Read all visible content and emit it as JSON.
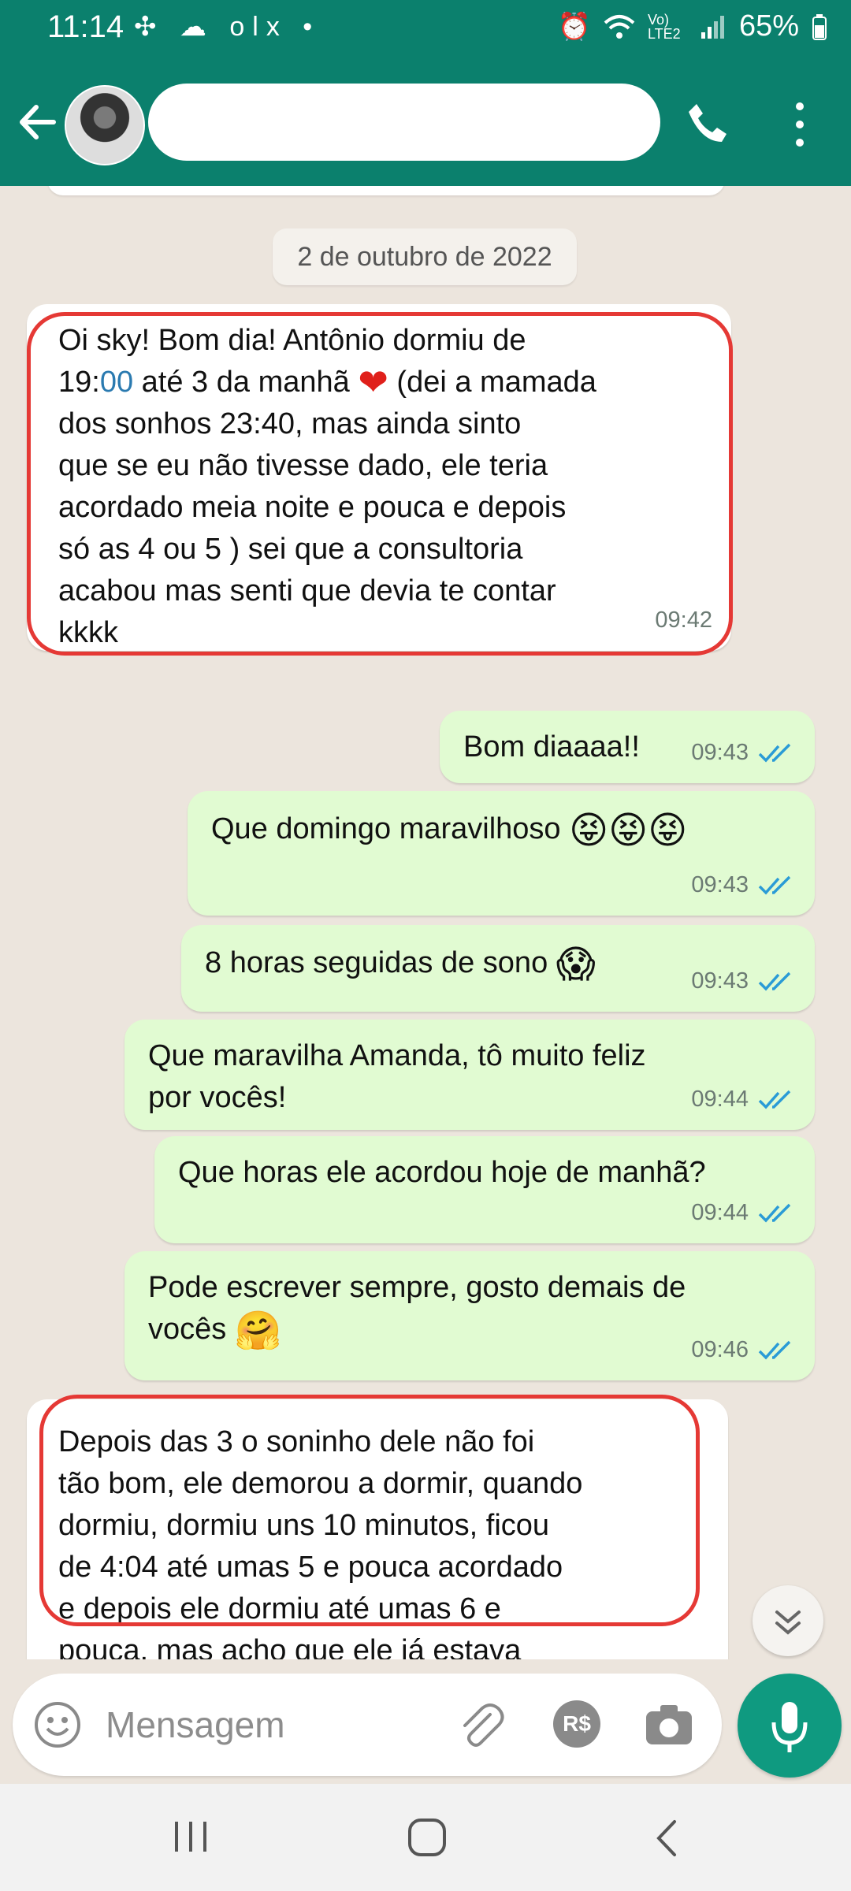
{
  "status_bar": {
    "time": "11:14",
    "left_icons": "✣ ☁ olx •",
    "network": "Vo) LTE2",
    "battery": "65%"
  },
  "header": {
    "contact_name": ""
  },
  "chat": {
    "date_label": "2 de outubro de 2022",
    "messages": [
      {
        "direction": "in",
        "text_1": "Oi sky! Bom dia! Antônio dormiu de\n19:",
        "text_highlight": "00",
        "text_2": " até 3 da manhã ",
        "heart": "❤",
        "text_3": " (dei a mamada\ndos sonhos 23:40, mas ainda sinto\nque se eu não tivesse dado, ele teria\nacordado meia noite e pouca e depois\nsó as 4 ou 5 ) sei que a consultoria\nacabou mas senti que devia te contar\nkkkk",
        "time": "09:42"
      },
      {
        "direction": "out",
        "text": "Bom diaaaa!!",
        "time": "09:43"
      },
      {
        "direction": "out",
        "text": "Que domingo maravilhoso ",
        "emoji": "😝😝😝",
        "time": "09:43"
      },
      {
        "direction": "out",
        "text": "8 horas seguidas de sono ",
        "emoji": "😱",
        "time": "09:43"
      },
      {
        "direction": "out",
        "text": "Que maravilha Amanda, tô muito feliz\npor vocês!",
        "time": "09:44"
      },
      {
        "direction": "out",
        "text": "Que horas ele acordou hoje de manhã?",
        "time": "09:44"
      },
      {
        "direction": "out",
        "text": "Pode escrever sempre, gosto demais de\nvocês ",
        "emoji": "🤗",
        "time": "09:46"
      },
      {
        "direction": "in",
        "text": "Depois das 3 o soninho dele não foi\ntão bom, ele demorou a dormir, quando\ndormiu,  dormiu uns 10 minutos, ficou\nde 4:04 até umas 5 e pouca acordado\ne depois ele dormiu até umas 6 e\npouca, mas acho que ele já estava"
      }
    ]
  },
  "input": {
    "placeholder": "Mensagem",
    "payment_label": "R$"
  },
  "icons": {
    "back": "arrow-left",
    "call": "phone",
    "menu": "more-vertical",
    "emoji": "smiley",
    "attach": "paperclip",
    "camera": "camera",
    "mic": "microphone",
    "scroll": "double-chevron-down"
  },
  "colors": {
    "header": "#0b806d",
    "chat_background": "#ece5dd",
    "outgoing_bubble": "#e1fbd2",
    "incoming_bubble": "#ffffff",
    "highlight_outline": "#e53935",
    "read_ticks": "#2a9bd6",
    "mic_button": "#0f9a80"
  }
}
